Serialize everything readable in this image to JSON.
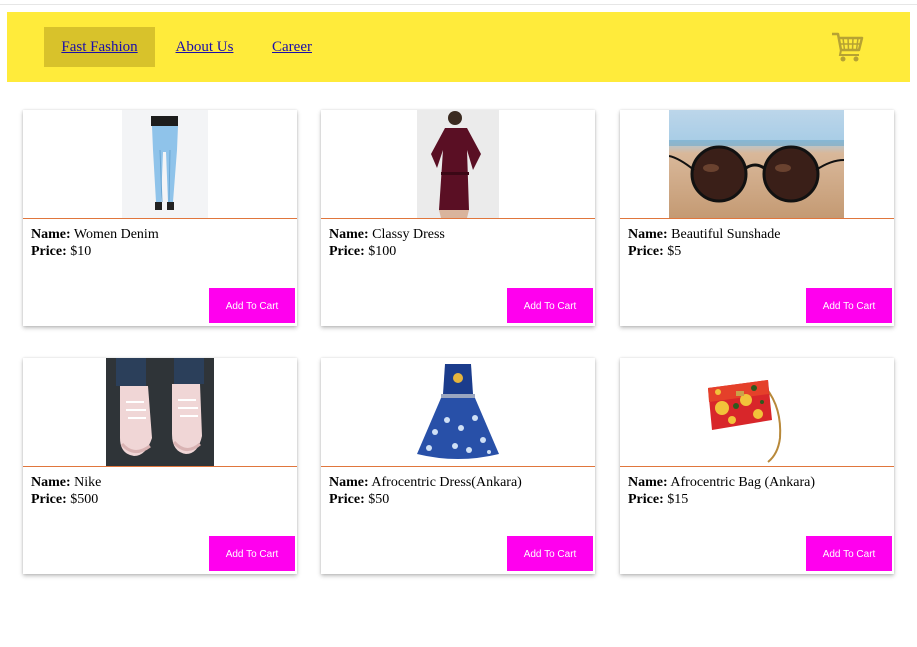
{
  "nav": {
    "brand": "Fast Fashion",
    "links": [
      "About Us",
      "Career"
    ]
  },
  "cart_icon": "shopping-cart-icon",
  "labels": {
    "name": "Name:",
    "price": "Price:"
  },
  "products": [
    {
      "name": "Women Denim",
      "price": "$10",
      "button": "Add To Cart"
    },
    {
      "name": "Classy Dress",
      "price": "$100",
      "button": "Add To Cart"
    },
    {
      "name": "Beautiful Sunshade",
      "price": "$5",
      "button": "Add To Cart"
    },
    {
      "name": "Nike",
      "price": "$500",
      "button": "Add To Cart"
    },
    {
      "name": "Afrocentric Dress(Ankara)",
      "price": "$50",
      "button": "Add To Cart"
    },
    {
      "name": "Afrocentric Bag (Ankara)",
      "price": "$15",
      "button": "Add To Cart"
    }
  ],
  "colors": {
    "navbar": "#ffeb3b",
    "active_tab": "#d8c22b",
    "button": "#ff00ee",
    "divider": "#e0763d"
  }
}
